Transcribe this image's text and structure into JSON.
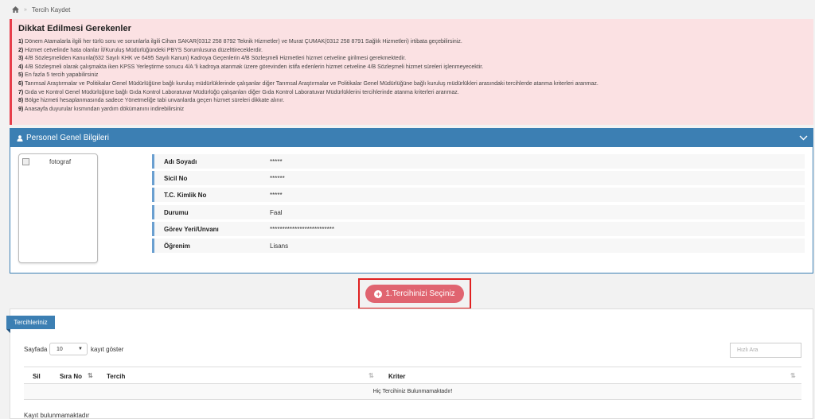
{
  "breadcrumb": {
    "home_icon": "home-icon",
    "separator": "»",
    "current": "Tercih Kaydet"
  },
  "alert": {
    "title": "Dikkat Edilmesi Gerekenler",
    "items": [
      {
        "num": "1)",
        "text": " Dönem Atamalarla ilgili her türlü soru ve sorunlarla ilgili Cihan SAKAR(0312 258 8792 Teknik Hizmetler) ve Murat ÇUMAK(0312 258 8791 Sağlık Hizmetleri) irtibata geçebilirsiniz."
      },
      {
        "num": "2)",
        "text": " Hizmet cetvelinde hata olanlar İl/Kuruluş Müdürlüğündeki PBYS Sorumlusuna düzelttireceklerdir."
      },
      {
        "num": "3)",
        "text": " 4/B Sözleşmeliden Kanunla(632 Sayılı KHK ve 6495 Sayılı Kanun) Kadroya Geçenlerin 4/B Sözleşmeli Hizmetleri hizmet cetveline girilmesi gerekmektedir."
      },
      {
        "num": "4)",
        "text": " 4/B Sözleşmeli olarak çalışmakta iken KPSS Yerleştirme sonucu 4/A 'li kadroya atanmak üzere görevinden istifa edenlerin hizmet cetveline 4/B Sözleşmeli hizmet süreleri işlenmeyecektir."
      },
      {
        "num": "5)",
        "text": " En fazla 5 tercih yapabilirsiniz"
      },
      {
        "num": "6)",
        "text": " Tarımsal Araştırmalar ve Politikalar Genel Müdürlüğüne bağlı kuruluş müdürlüklerinde çalışanlar diğer Tarımsal Araştırmalar ve Politikalar Genel Müdürlüğüne bağlı kuruluş müdürlükleri arasındaki tercihlerde atanma kriterleri aranmaz."
      },
      {
        "num": "7)",
        "text": " Gıda ve Kontrol Genel Müdürlüğüne bağlı Gıda Kontrol Laboratuvar Müdürlüğü çalışanları diğer Gıda Kontrol Laboratuvar Müdürlüklerini tercihlerinde atanma kriterleri aranmaz."
      },
      {
        "num": "8)",
        "text": " Bölge hizmeti hesaplanmasında sadece Yönetmeliğe tabi unvanlarda geçen hizmet süreleri dikkate alınır."
      },
      {
        "num": "9)",
        "text": " Anasayfa duyurular kısmından yardım dökümanını indirebilirsiniz"
      }
    ]
  },
  "personel": {
    "title": "Personel Genel Bilgileri",
    "photo_alt": "fotograf",
    "rows": [
      {
        "label": "Adı Soyadı",
        "value": "*****"
      },
      {
        "label": "Sicil No",
        "value": "******"
      },
      {
        "label": "T.C. Kimlik No",
        "value": "*****"
      },
      {
        "label": "Durumu",
        "value": "Faal"
      },
      {
        "label": "Görev Yeri/Unvanı",
        "value": "**************************"
      },
      {
        "label": "Öğrenim",
        "value": "Lisans"
      }
    ]
  },
  "choose_button": {
    "label": "1.Tercihinizi Seçiniz"
  },
  "preferences": {
    "tab_label": "Tercihleriniz",
    "length_prefix": "Sayfada",
    "length_value": "10",
    "length_suffix": "kayıt göster",
    "search_placeholder": "Hızlı Ara",
    "columns": [
      "Sil",
      "Sıra No",
      "Tercih",
      "Kriter"
    ],
    "empty_message": "Hiç Tercihiniz Bulunmamaktadır!",
    "info": "Kayıt bulunmamaktadır"
  },
  "colors": {
    "primary": "#3c7fb3",
    "danger_bg": "#fbe1e3",
    "danger_border": "#e73d4a",
    "button": "#e06470",
    "highlight": "#e02020"
  }
}
